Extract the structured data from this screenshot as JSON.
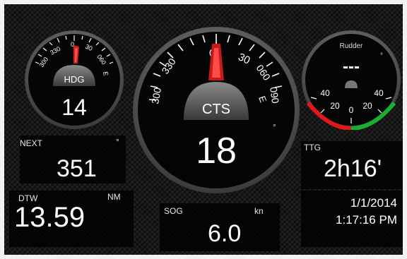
{
  "hdg_gauge": {
    "label": "HDG",
    "value": "14",
    "ticks": [
      "300",
      "330",
      "0",
      "30",
      "060",
      "E"
    ]
  },
  "cts_gauge": {
    "label": "CTS",
    "value": "18",
    "ticks": [
      "300",
      "330",
      "0",
      "30",
      "060",
      "090",
      "E"
    ]
  },
  "rudder_gauge": {
    "title": "Rudder",
    "value": "---",
    "ticks": [
      "40",
      "20",
      "0",
      "20",
      "40"
    ],
    "colors": {
      "port": "#e01818",
      "starboard": "#18b030"
    }
  },
  "next": {
    "label": "NEXT",
    "unit": "°",
    "value": "351"
  },
  "dtw": {
    "label": "DTW",
    "unit": "NM",
    "value": "13.59"
  },
  "sog": {
    "label": "SOG",
    "unit": "kn",
    "value": "6.0"
  },
  "ttg": {
    "label": "TTG",
    "value": "2h16'"
  },
  "datetime": {
    "date": "1/1/2014",
    "time": "1:17:16 PM"
  }
}
